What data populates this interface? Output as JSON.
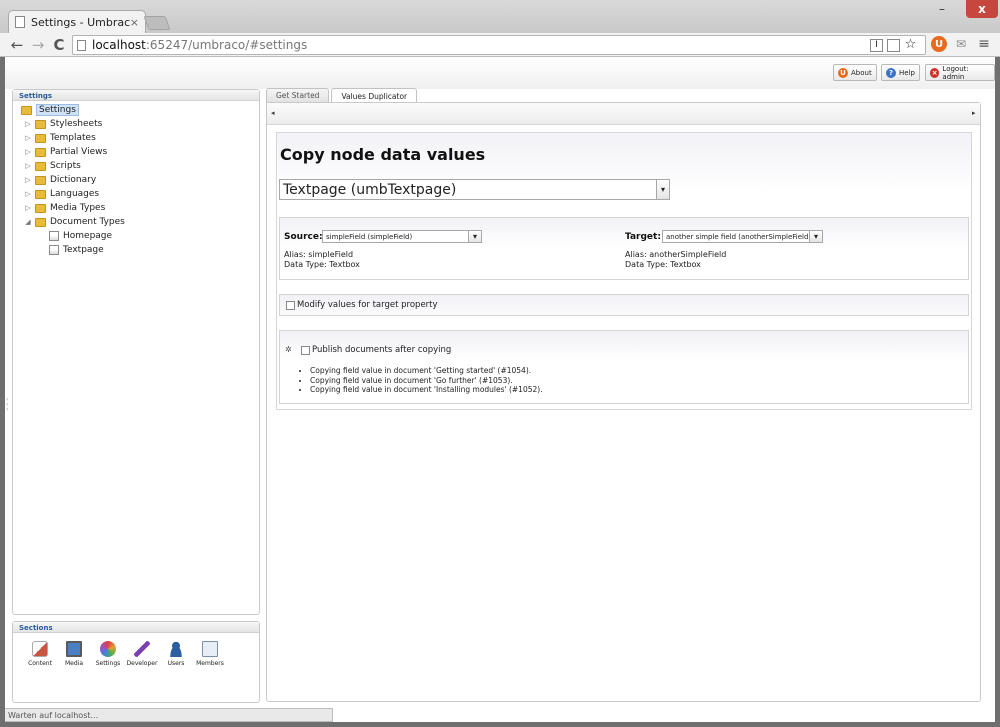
{
  "browser": {
    "tab_title": "Settings - Umbraco CMS",
    "tab_close": "×",
    "url_host": "localhost",
    "url_path": ":65247/umbraco/#settings",
    "back": "←",
    "forward": "→",
    "reload": "C",
    "min": "–",
    "max": "□",
    "close": "x",
    "status": "Warten auf localhost..."
  },
  "topbar": {
    "about": "About",
    "help": "Help",
    "logout": "Logout: admin"
  },
  "tree": {
    "title": "Settings",
    "root": "Settings",
    "items": [
      {
        "label": "Stylesheets",
        "exp": "▷"
      },
      {
        "label": "Templates",
        "exp": "▷"
      },
      {
        "label": "Partial Views",
        "exp": "▷"
      },
      {
        "label": "Scripts",
        "exp": "▷"
      },
      {
        "label": "Dictionary",
        "exp": "▷"
      },
      {
        "label": "Languages",
        "exp": "▷"
      },
      {
        "label": "Media Types",
        "exp": "▷"
      },
      {
        "label": "Document Types",
        "exp": "◢"
      }
    ],
    "children": [
      "Homepage",
      "Textpage"
    ]
  },
  "sections": {
    "title": "Sections",
    "items": [
      {
        "label": "Content",
        "color": "#c8553d"
      },
      {
        "label": "Media",
        "color": "#4a7fc1"
      },
      {
        "label": "Settings",
        "color": "#e0a030"
      },
      {
        "label": "Developer",
        "color": "#7a3fb0"
      },
      {
        "label": "Users",
        "color": "#2c5fa0"
      },
      {
        "label": "Members",
        "color": "#7c8fa8"
      }
    ]
  },
  "tabs": [
    "Get Started",
    "Values Duplicator"
  ],
  "main": {
    "heading": "Copy node data values",
    "doc_type": "Textpage (umbTextpage)",
    "source_label": "Source:",
    "source_value": "simpleField (simpleField)",
    "source_alias": "Alias: simpleField",
    "source_type": "Data Type: Textbox",
    "target_label": "Target:",
    "target_value": "another simple field (anotherSimpleField)",
    "target_alias": "Alias: anotherSimpleField",
    "target_type": "Data Type: Textbox",
    "modify_label": "Modify values for target property",
    "publish_label": "Publish documents after copying",
    "messages": [
      "Copying field value in document 'Getting started' (#1054).",
      "Copying field value in document 'Go further' (#1053).",
      "Copying field value in document 'Installing modules' (#1052)."
    ]
  }
}
